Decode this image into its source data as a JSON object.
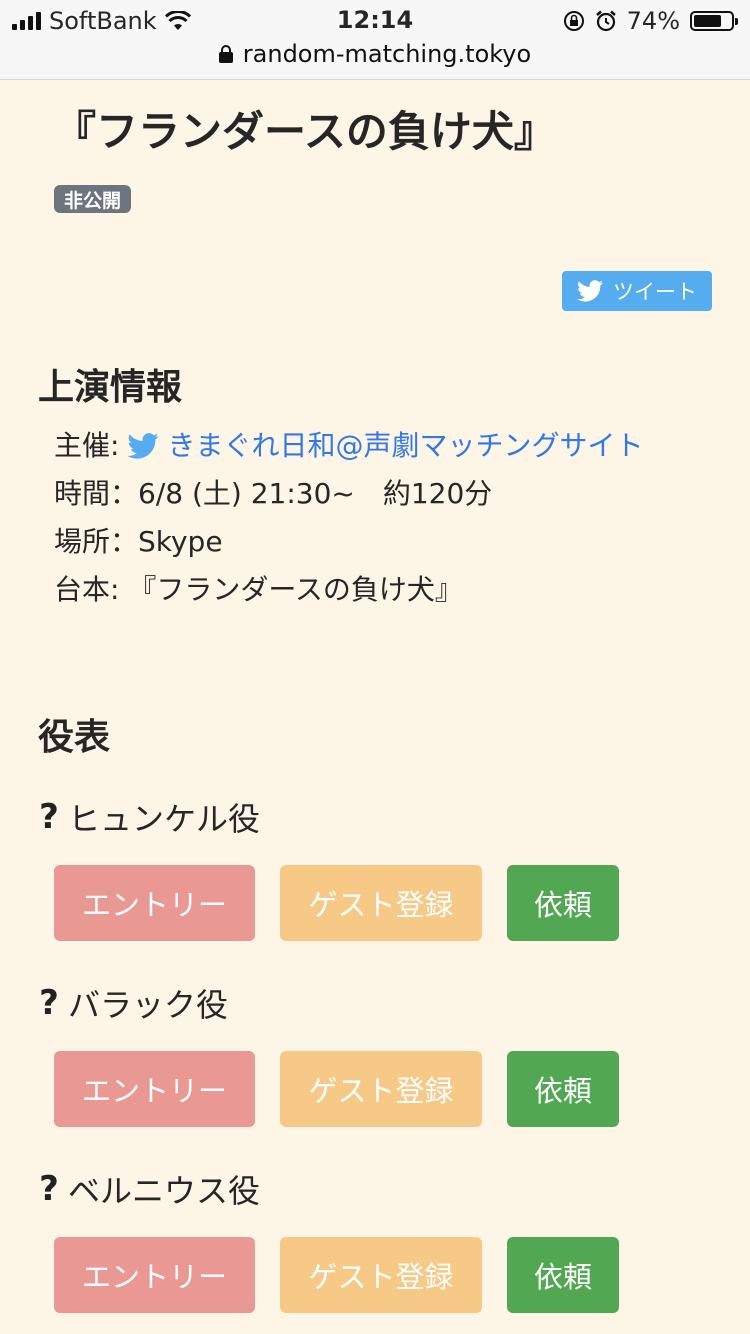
{
  "status_bar": {
    "carrier": "SoftBank",
    "time": "12:14",
    "battery": "74%",
    "battery_fraction": 0.74,
    "url": "random-matching.tokyo"
  },
  "header": {
    "title": "『フランダースの負け犬』",
    "badge": "非公開",
    "tweet_label": "ツイート"
  },
  "performance": {
    "section_title": "上演情報",
    "host_label": "主催:",
    "host_name": "きまぐれ日和@声劇マッチングサイト",
    "time_text": "時間：6/8 (土) 21:30~　約120分",
    "place_text": "場所：Skype",
    "script_text": "台本: 『フランダースの負け犬』"
  },
  "cast": {
    "section_title": "役表",
    "roles": [
      {
        "name": "ヒュンケル役",
        "status_icon": "question-icon",
        "entry": "エントリー",
        "guest": "ゲスト登録",
        "request": "依頼"
      },
      {
        "name": "バラック役",
        "status_icon": "question-icon",
        "entry": "エントリー",
        "guest": "ゲスト登録",
        "request": "依頼"
      },
      {
        "name": "ベルニウス役",
        "status_icon": "question-icon",
        "entry": "エントリー",
        "guest": "ゲスト登録",
        "request": "依頼"
      }
    ]
  },
  "colors": {
    "background": "#fdf5e5",
    "badge": "#6c757d",
    "twitter": "#55acee",
    "link": "#3478e6",
    "entry": "#e99893",
    "guest": "#f6c986",
    "request": "#52a752"
  }
}
